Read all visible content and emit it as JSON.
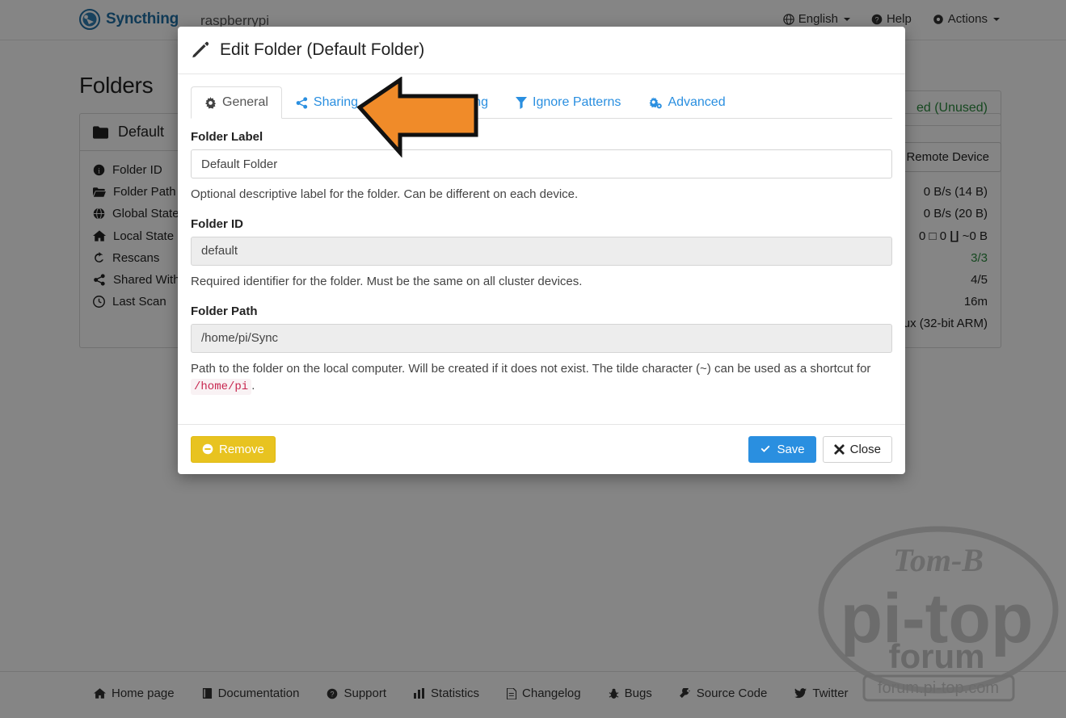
{
  "navbar": {
    "brand": "Syncthing",
    "device_name": "raspberrypi",
    "language": "English",
    "help": "Help",
    "actions": "Actions"
  },
  "page": {
    "title": "Folders",
    "folder": {
      "name": "Default",
      "rows": [
        {
          "icon": "info-icon",
          "label": "Folder ID",
          "value": ""
        },
        {
          "icon": "folder-open-icon",
          "label": "Folder Path",
          "value": "0 B/s (14 B)"
        },
        {
          "icon": "globe-icon",
          "label": "Global State",
          "value": "0 B/s (20 B)"
        },
        {
          "icon": "home-icon",
          "label": "Local State",
          "value": "0   □ 0   ∐ ~0 B"
        },
        {
          "icon": "refresh-icon",
          "label": "Rescans",
          "value": "3/3"
        },
        {
          "icon": "share-icon",
          "label": "Shared With",
          "value": "4/5"
        },
        {
          "icon": "clock-icon",
          "label": "Last Scan",
          "value": "16m"
        }
      ],
      "platform": "ux (32-bit ARM)"
    },
    "device_status": "ed (Unused)",
    "add_remote_device": "d Remote Device"
  },
  "modal": {
    "title": "Edit Folder (Default Folder)",
    "title_icon": "pencil-icon",
    "tabs": [
      {
        "label": "General",
        "icon": "gear-icon",
        "active": true
      },
      {
        "label": "Sharing",
        "icon": "share-icon",
        "active": false
      },
      {
        "label": "File Versioning",
        "icon": "history-icon",
        "active": false
      },
      {
        "label": "Ignore Patterns",
        "icon": "filter-icon",
        "active": false
      },
      {
        "label": "Advanced",
        "icon": "gears-icon",
        "active": false
      }
    ],
    "fields": {
      "folder_label": {
        "label": "Folder Label",
        "value": "Default Folder",
        "placeholder": "Folder Label",
        "help": "Optional descriptive label for the folder. Can be different on each device."
      },
      "folder_id": {
        "label": "Folder ID",
        "value": "default",
        "placeholder": "Folder ID",
        "help": "Required identifier for the folder. Must be the same on all cluster devices."
      },
      "folder_path": {
        "label": "Folder Path",
        "value": "/home/pi/Sync",
        "placeholder": "Folder Path",
        "help_part1": "Path to the folder on the local computer. Will be created if it does not exist. The tilde character (~) can be used as a shortcut for",
        "help_code": "/home/pi",
        "help_part2": "."
      }
    },
    "buttons": {
      "remove": "Remove",
      "save": "Save",
      "close": "Close"
    }
  },
  "footer": {
    "links": [
      {
        "label": "Home page",
        "icon": "home-icon"
      },
      {
        "label": "Documentation",
        "icon": "book-icon"
      },
      {
        "label": "Support",
        "icon": "question-circle-icon"
      },
      {
        "label": "Statistics",
        "icon": "bar-chart-icon"
      },
      {
        "label": "Changelog",
        "icon": "file-text-icon"
      },
      {
        "label": "Bugs",
        "icon": "bug-icon"
      },
      {
        "label": "Source Code",
        "icon": "wrench-icon"
      },
      {
        "label": "Twitter",
        "icon": "twitter-icon"
      }
    ]
  },
  "watermark": {
    "top_text": "Tom-B",
    "main_text": "pi-top",
    "sub_text": "forum",
    "url": "forum.pi-top.com"
  },
  "colors": {
    "brand_blue": "#1f6fa5",
    "link_blue": "#2a8fe0",
    "arrow_orange": "#f08b29",
    "warning_yellow": "#e8c320",
    "success_green": "#2b8a3e",
    "code_pink": "#c7254e"
  },
  "annotation": {
    "arrow_name": "orange-pointer-arrow",
    "arrow_direction": "left",
    "points_at": "Sharing"
  }
}
